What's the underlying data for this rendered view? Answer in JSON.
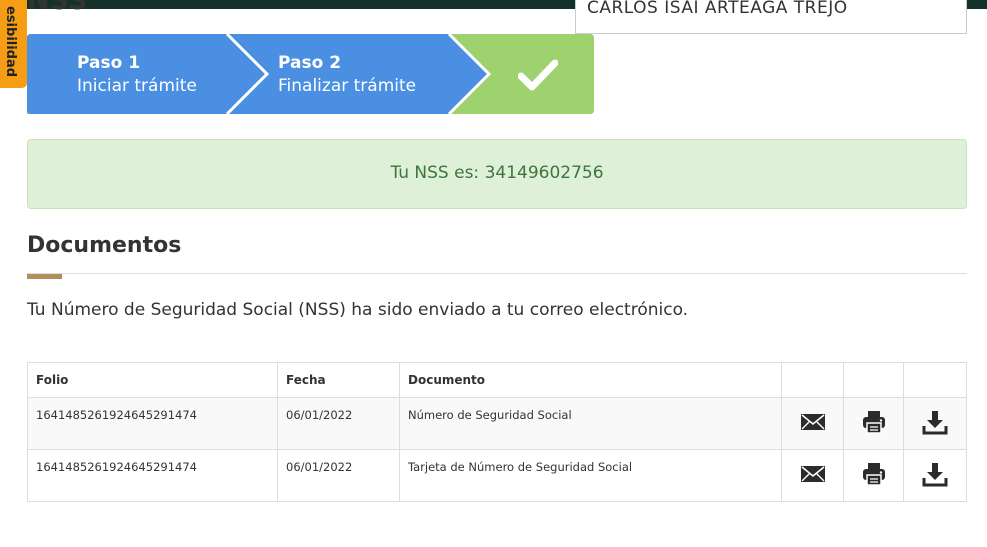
{
  "header": {
    "title": "NSS",
    "user_name": "CARLOS ISAI ARTEAGA TREJO",
    "accessibility_label": "esibilidad"
  },
  "stepper": {
    "steps": [
      {
        "number": "Paso 1",
        "label": "Iniciar trámite"
      },
      {
        "number": "Paso 2",
        "label": "Finalizar trámite"
      }
    ],
    "complete_icon": "check-icon"
  },
  "alert": {
    "text": "Tu NSS es: 34149602756"
  },
  "documents": {
    "title": "Documentos",
    "message": "Tu Número de Seguridad Social (NSS) ha sido enviado a tu correo electrónico.",
    "columns": [
      "Folio",
      "Fecha",
      "Documento",
      "",
      "",
      ""
    ],
    "rows": [
      {
        "folio": "1641485261924645291474",
        "fecha": "06/01/2022",
        "documento": "Número de Seguridad Social"
      },
      {
        "folio": "1641485261924645291474",
        "fecha": "06/01/2022",
        "documento": "Tarjeta de Número de Seguridad Social"
      }
    ],
    "actions": [
      "envelope-icon",
      "print-icon",
      "download-icon"
    ]
  },
  "colors": {
    "topbar": "#13322b",
    "step_blue": "#4a8fe2",
    "step_green": "#9ed26e",
    "alert_bg": "#dff0d8",
    "alert_text": "#3c763d",
    "accent_gold": "#b38e5d",
    "accessibility_orange": "#f49d15"
  }
}
